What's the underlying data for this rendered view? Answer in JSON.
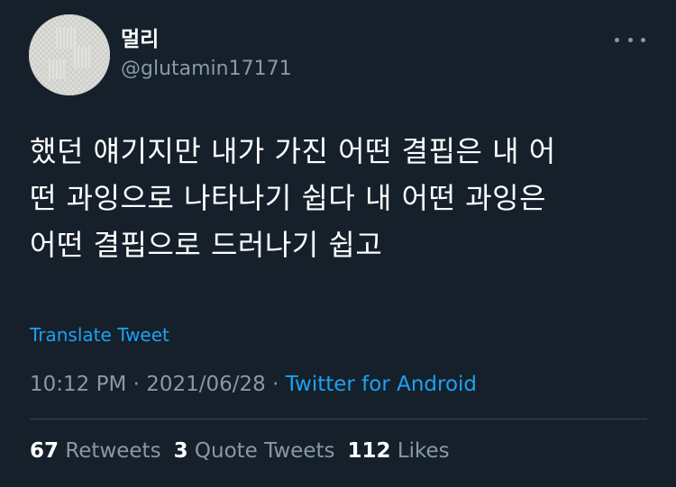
{
  "author": {
    "display_name": "멀리",
    "handle": "@glutamin17171"
  },
  "icons": {
    "more": "more-horizontal-icon",
    "avatar": "avatar-image"
  },
  "tweet": {
    "lines": [
      "했던 얘기지만 내가 가진 어떤 결핍은 내 어",
      "떤 과잉으로 나타나기 쉽다 내 어떤 과잉은",
      "어떤 결핍으로 드러나기 쉽고"
    ],
    "translate_label": "Translate Tweet",
    "time": "10:12 PM",
    "separator": "·",
    "date": "2021/06/28",
    "source": "Twitter for Android"
  },
  "stats": {
    "retweets_count": "67",
    "retweets_label": "Retweets",
    "quotes_count": "3",
    "quotes_label": "Quote Tweets",
    "likes_count": "112",
    "likes_label": "Likes"
  },
  "colors": {
    "background": "#15202b",
    "primary_text": "#ffffff",
    "secondary_text": "#8899a6",
    "accent": "#1da1f2",
    "divider": "#38444d"
  }
}
